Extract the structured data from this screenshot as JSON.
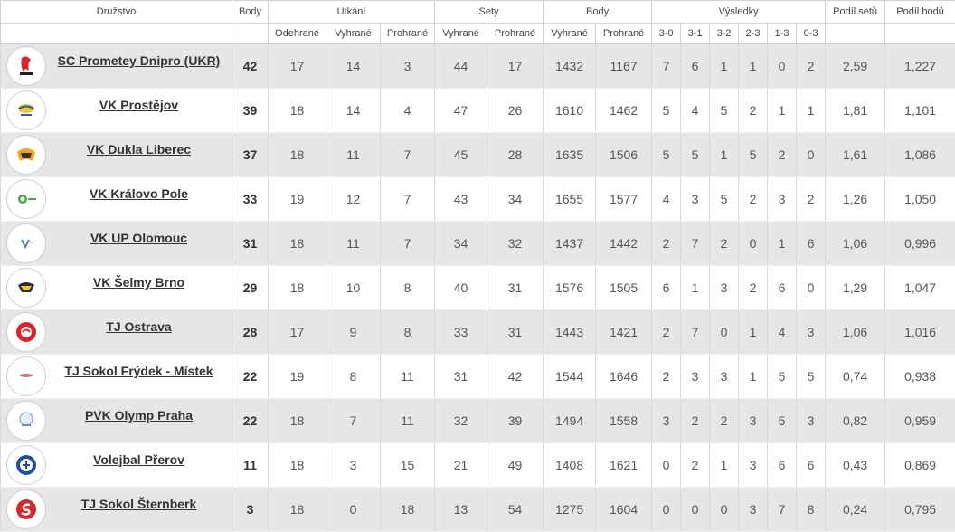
{
  "header": {
    "team": "Družstvo",
    "points": "Body",
    "matches": "Utkání",
    "sets": "Sety",
    "ballpoints": "Body",
    "results": "Výsledky",
    "set_ratio": "Podíl setů",
    "point_ratio": "Podíl bodů",
    "sub": {
      "played": "Odehrané",
      "won": "Vyhrané",
      "lost": "Prohrané",
      "sets_won": "Vyhrané",
      "sets_lost": "Prohrané",
      "pts_won": "Vyhrané",
      "pts_lost": "Prohrané",
      "r30": "3-0",
      "r31": "3-1",
      "r32": "3-2",
      "r23": "2-3",
      "r13": "1-3",
      "r03": "0-3"
    }
  },
  "rows": [
    {
      "team": "SC Prometey Dnipro (UKR)",
      "logo": "prometey-logo",
      "points": "42",
      "played": "17",
      "won": "14",
      "lost": "3",
      "sw": "44",
      "sl": "17",
      "pw": "1432",
      "pl": "1167",
      "r30": "7",
      "r31": "6",
      "r32": "1",
      "r23": "1",
      "r13": "0",
      "r03": "2",
      "sr": "2,59",
      "pr": "1,227"
    },
    {
      "team": "VK Prostějov",
      "logo": "prostejov-logo",
      "points": "39",
      "played": "18",
      "won": "14",
      "lost": "4",
      "sw": "47",
      "sl": "26",
      "pw": "1610",
      "pl": "1462",
      "r30": "5",
      "r31": "4",
      "r32": "5",
      "r23": "2",
      "r13": "1",
      "r03": "1",
      "sr": "1,81",
      "pr": "1,101"
    },
    {
      "team": "VK Dukla Liberec",
      "logo": "dukla-logo",
      "points": "37",
      "played": "18",
      "won": "11",
      "lost": "7",
      "sw": "45",
      "sl": "28",
      "pw": "1635",
      "pl": "1506",
      "r30": "5",
      "r31": "5",
      "r32": "1",
      "r23": "5",
      "r13": "2",
      "r03": "0",
      "sr": "1,61",
      "pr": "1,086"
    },
    {
      "team": "VK Královo Pole",
      "logo": "kralovo-pole-logo",
      "points": "33",
      "played": "19",
      "won": "12",
      "lost": "7",
      "sw": "43",
      "sl": "34",
      "pw": "1655",
      "pl": "1577",
      "r30": "4",
      "r31": "3",
      "r32": "5",
      "r23": "2",
      "r13": "3",
      "r03": "2",
      "sr": "1,26",
      "pr": "1,050"
    },
    {
      "team": "VK UP Olomouc",
      "logo": "olomouc-logo",
      "points": "31",
      "played": "18",
      "won": "11",
      "lost": "7",
      "sw": "34",
      "sl": "32",
      "pw": "1437",
      "pl": "1442",
      "r30": "2",
      "r31": "7",
      "r32": "2",
      "r23": "0",
      "r13": "1",
      "r03": "6",
      "sr": "1,06",
      "pr": "0,996"
    },
    {
      "team": "VK Šelmy Brno",
      "logo": "selmy-logo",
      "points": "29",
      "played": "18",
      "won": "10",
      "lost": "8",
      "sw": "40",
      "sl": "31",
      "pw": "1576",
      "pl": "1505",
      "r30": "6",
      "r31": "1",
      "r32": "3",
      "r23": "2",
      "r13": "6",
      "r03": "0",
      "sr": "1,29",
      "pr": "1,047"
    },
    {
      "team": "TJ Ostrava",
      "logo": "ostrava-logo",
      "points": "28",
      "played": "17",
      "won": "9",
      "lost": "8",
      "sw": "33",
      "sl": "31",
      "pw": "1443",
      "pl": "1421",
      "r30": "2",
      "r31": "7",
      "r32": "0",
      "r23": "1",
      "r13": "4",
      "r03": "3",
      "sr": "1,06",
      "pr": "1,016"
    },
    {
      "team": "TJ Sokol Frýdek - Místek",
      "logo": "frydek-logo",
      "points": "22",
      "played": "19",
      "won": "8",
      "lost": "11",
      "sw": "31",
      "sl": "42",
      "pw": "1544",
      "pl": "1646",
      "r30": "2",
      "r31": "3",
      "r32": "3",
      "r23": "1",
      "r13": "5",
      "r03": "5",
      "sr": "0,74",
      "pr": "0,938"
    },
    {
      "team": "PVK Olymp Praha",
      "logo": "olymp-logo",
      "points": "22",
      "played": "18",
      "won": "7",
      "lost": "11",
      "sw": "32",
      "sl": "39",
      "pw": "1494",
      "pl": "1558",
      "r30": "3",
      "r31": "2",
      "r32": "2",
      "r23": "3",
      "r13": "5",
      "r03": "3",
      "sr": "0,82",
      "pr": "0,959"
    },
    {
      "team": "Volejbal Přerov",
      "logo": "prerov-logo",
      "points": "11",
      "played": "18",
      "won": "3",
      "lost": "15",
      "sw": "21",
      "sl": "49",
      "pw": "1408",
      "pl": "1621",
      "r30": "0",
      "r31": "2",
      "r32": "1",
      "r23": "3",
      "r13": "6",
      "r03": "6",
      "sr": "0,43",
      "pr": "0,869"
    },
    {
      "team": "TJ Sokol Šternberk",
      "logo": "sternberk-logo",
      "points": "3",
      "played": "18",
      "won": "0",
      "lost": "18",
      "sw": "13",
      "sl": "54",
      "pw": "1275",
      "pl": "1604",
      "r30": "0",
      "r31": "0",
      "r32": "0",
      "r23": "3",
      "r13": "7",
      "r03": "8",
      "sr": "0,24",
      "pr": "0,795"
    }
  ]
}
